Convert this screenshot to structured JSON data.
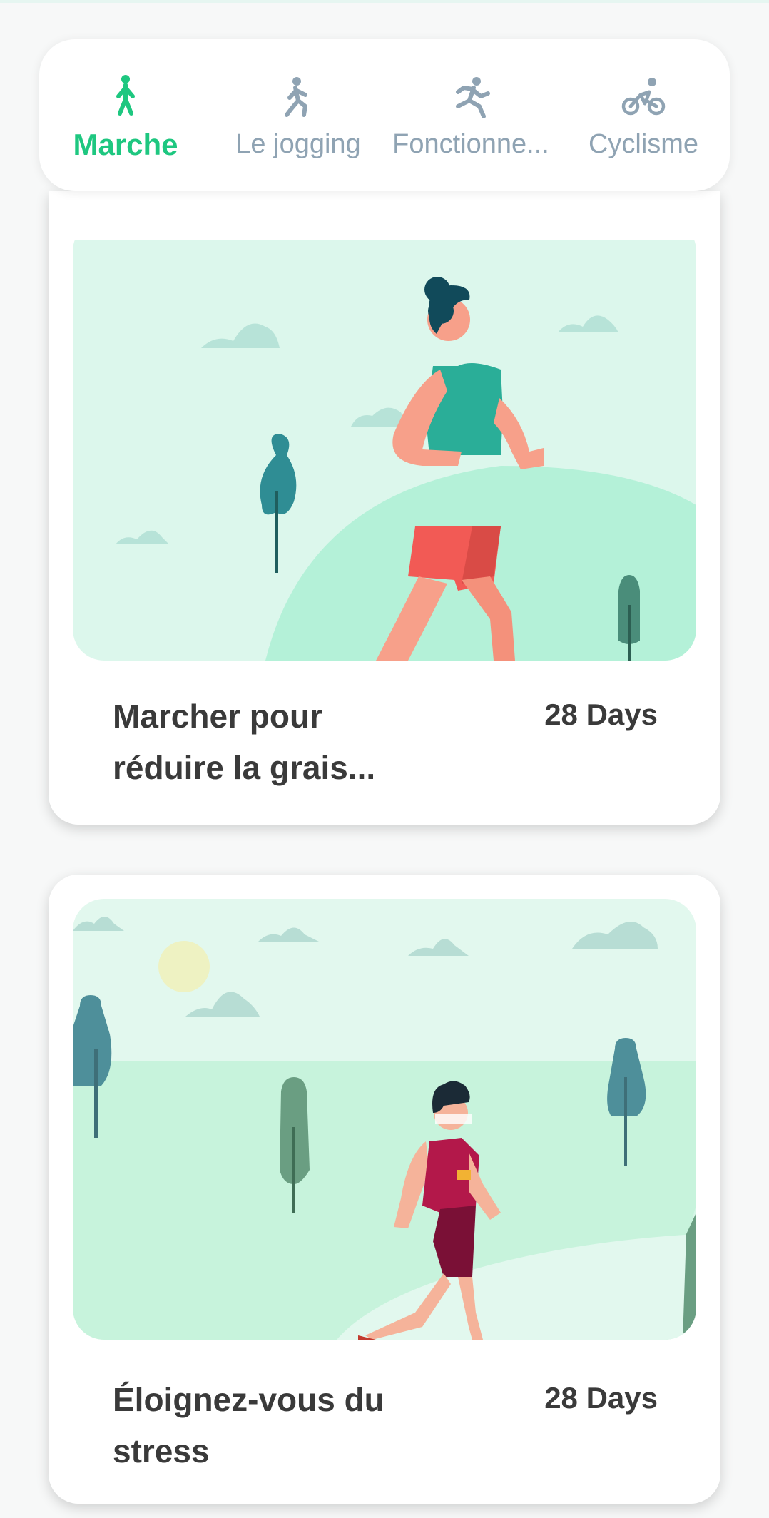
{
  "tabs": [
    {
      "label": "Marche",
      "icon": "walk-icon",
      "active": true
    },
    {
      "label": "Le jogging",
      "icon": "jogging-icon",
      "active": false
    },
    {
      "label": "Fonctionne...",
      "icon": "running-icon",
      "active": false
    },
    {
      "label": "Cyclisme",
      "icon": "cycling-icon",
      "active": false
    }
  ],
  "colors": {
    "accent": "#1ec780",
    "inactive": "#8fa3b3",
    "text": "#3a3a3a",
    "art_bg": "#dcf7ec"
  },
  "programs": [
    {
      "title": "Marcher pour réduire la grais...",
      "duration": "28 Days",
      "image": "woman-jogging-illustration"
    },
    {
      "title": "Éloignez-vous du stress",
      "duration": "28 Days",
      "image": "man-walking-illustration"
    }
  ]
}
